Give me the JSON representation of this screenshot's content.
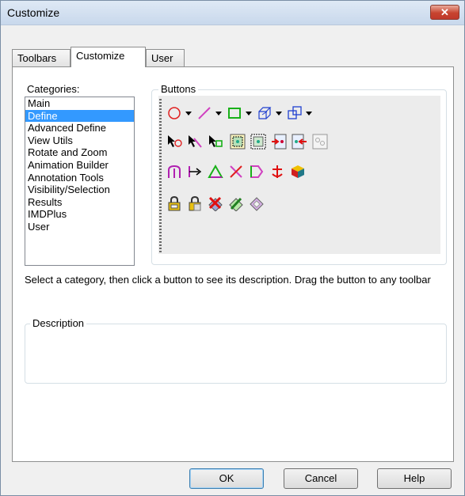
{
  "window": {
    "title": "Customize",
    "close_symbol": "✕"
  },
  "tabs": [
    {
      "label": "Toolbars",
      "active": false
    },
    {
      "label": "Customize",
      "active": true
    },
    {
      "label": "User",
      "active": false
    }
  ],
  "categories": {
    "label": "Categories:",
    "items": [
      "Main",
      "Define",
      "Advanced Define",
      "View Utils",
      "Rotate and Zoom",
      "Animation Builder",
      "Annotation Tools",
      "Visibility/Selection",
      "Results",
      "IMDPlus",
      "User"
    ],
    "selected": "Define"
  },
  "buttons_group": {
    "label": "Buttons",
    "rows": [
      [
        "circle-icon",
        "line-icon",
        "rectangle-icon",
        "box-3d-icon",
        "overlap-squares-icon"
      ],
      [
        "pick-circle-icon",
        "pick-line-icon",
        "pick-square-icon",
        "grid-select-icon",
        "grid-dotted-select-icon",
        "grid-add-icon",
        "grid-remove-icon",
        "grid-gray-icon"
      ],
      [
        "pillar-icon",
        "dimension-icon",
        "triangle-icon",
        "cross-icon",
        "flag-icon",
        "anchor-icon",
        "cube-color-icon"
      ],
      [
        "lock-icon",
        "lock-grid-icon",
        "delete-grid-icon",
        "pencil-grid-icon",
        "eraser-grid-icon"
      ]
    ]
  },
  "instructions": "Select a category, then click a button to see its description. Drag the button to any toolbar",
  "description": {
    "label": "Description",
    "text": ""
  },
  "actions": {
    "ok": "OK",
    "cancel": "Cancel",
    "help": "Help"
  },
  "colors": {
    "selection": "#3399ff",
    "dialog_bg": "#f0f0f0",
    "close_red": "#c7442f"
  }
}
